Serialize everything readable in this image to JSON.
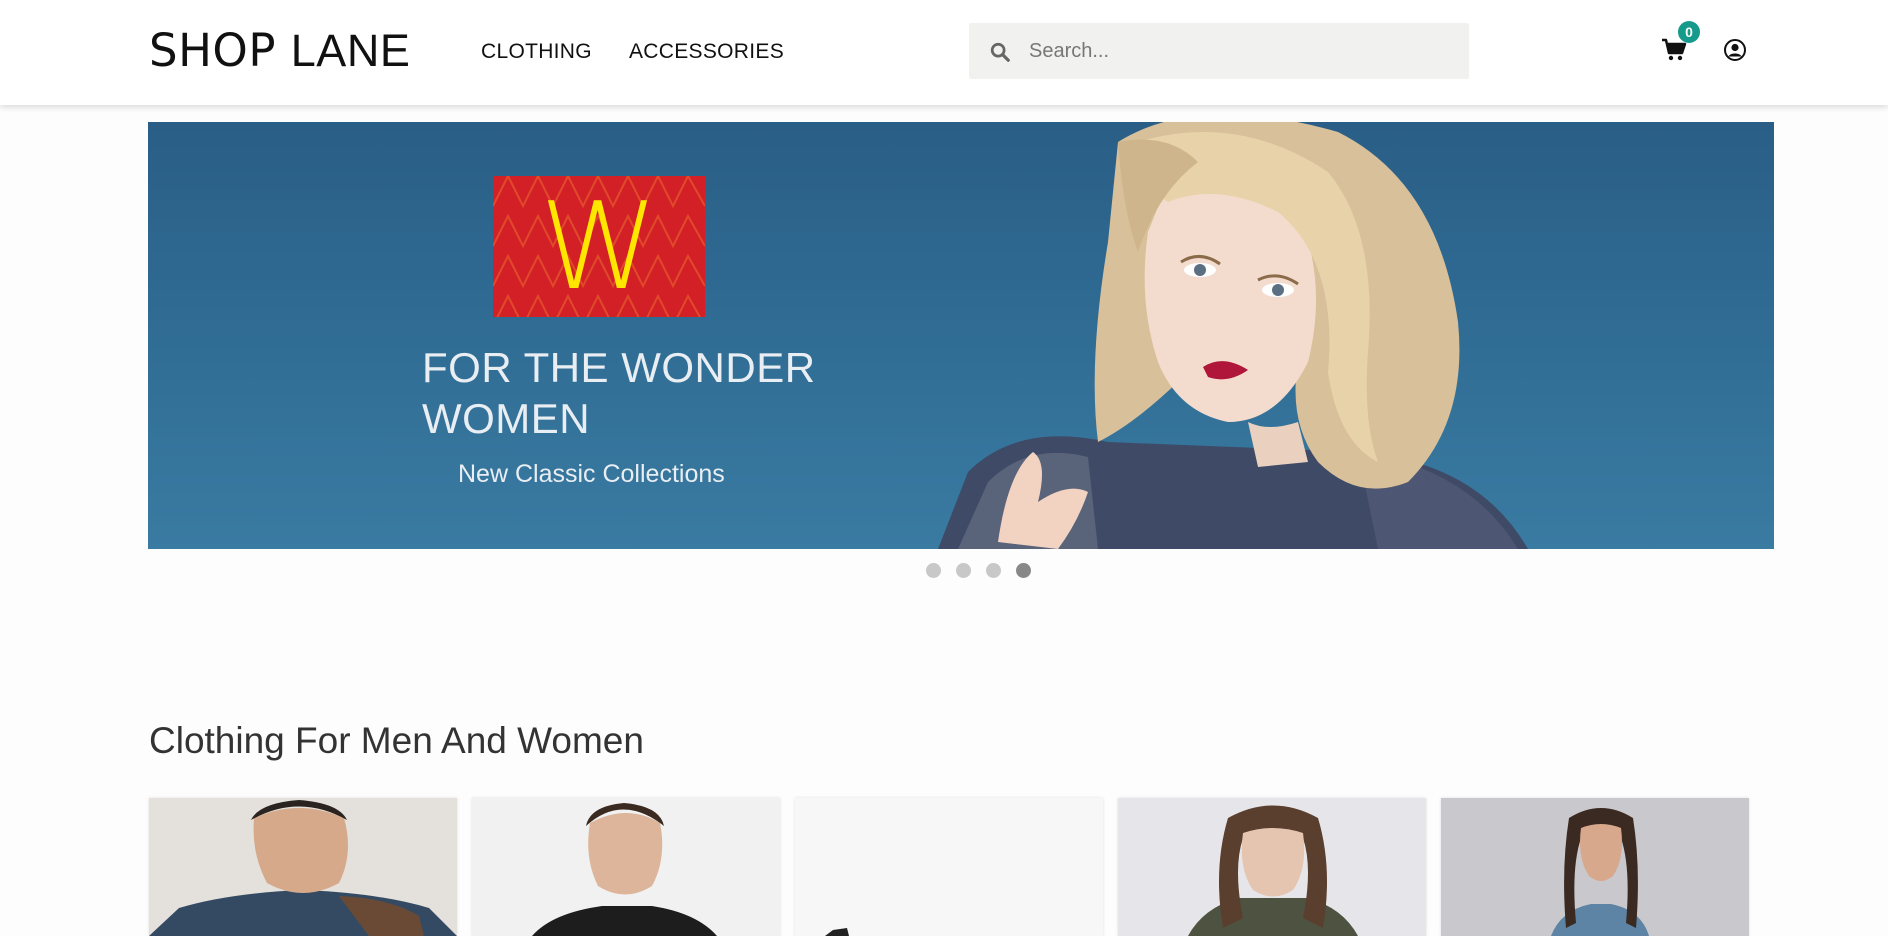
{
  "header": {
    "logo_part1": "SHOP",
    "logo_part2": "LANE",
    "nav": [
      {
        "label": "CLOTHING"
      },
      {
        "label": "ACCESSORIES"
      }
    ],
    "search_placeholder": "Search...",
    "cart_count": "0"
  },
  "banner": {
    "logo_letter": "W",
    "headline": "FOR THE WONDER WOMEN",
    "subline": "New Classic Collections",
    "slide_count": 4,
    "active_slide": 4
  },
  "section": {
    "title": "Clothing For Men And Women",
    "product_count_visible": 5
  },
  "colors": {
    "accent": "#159a8c",
    "banner_bg": "#2f6b93",
    "logo_red": "#d22026",
    "logo_yellow": "#ffe600"
  }
}
